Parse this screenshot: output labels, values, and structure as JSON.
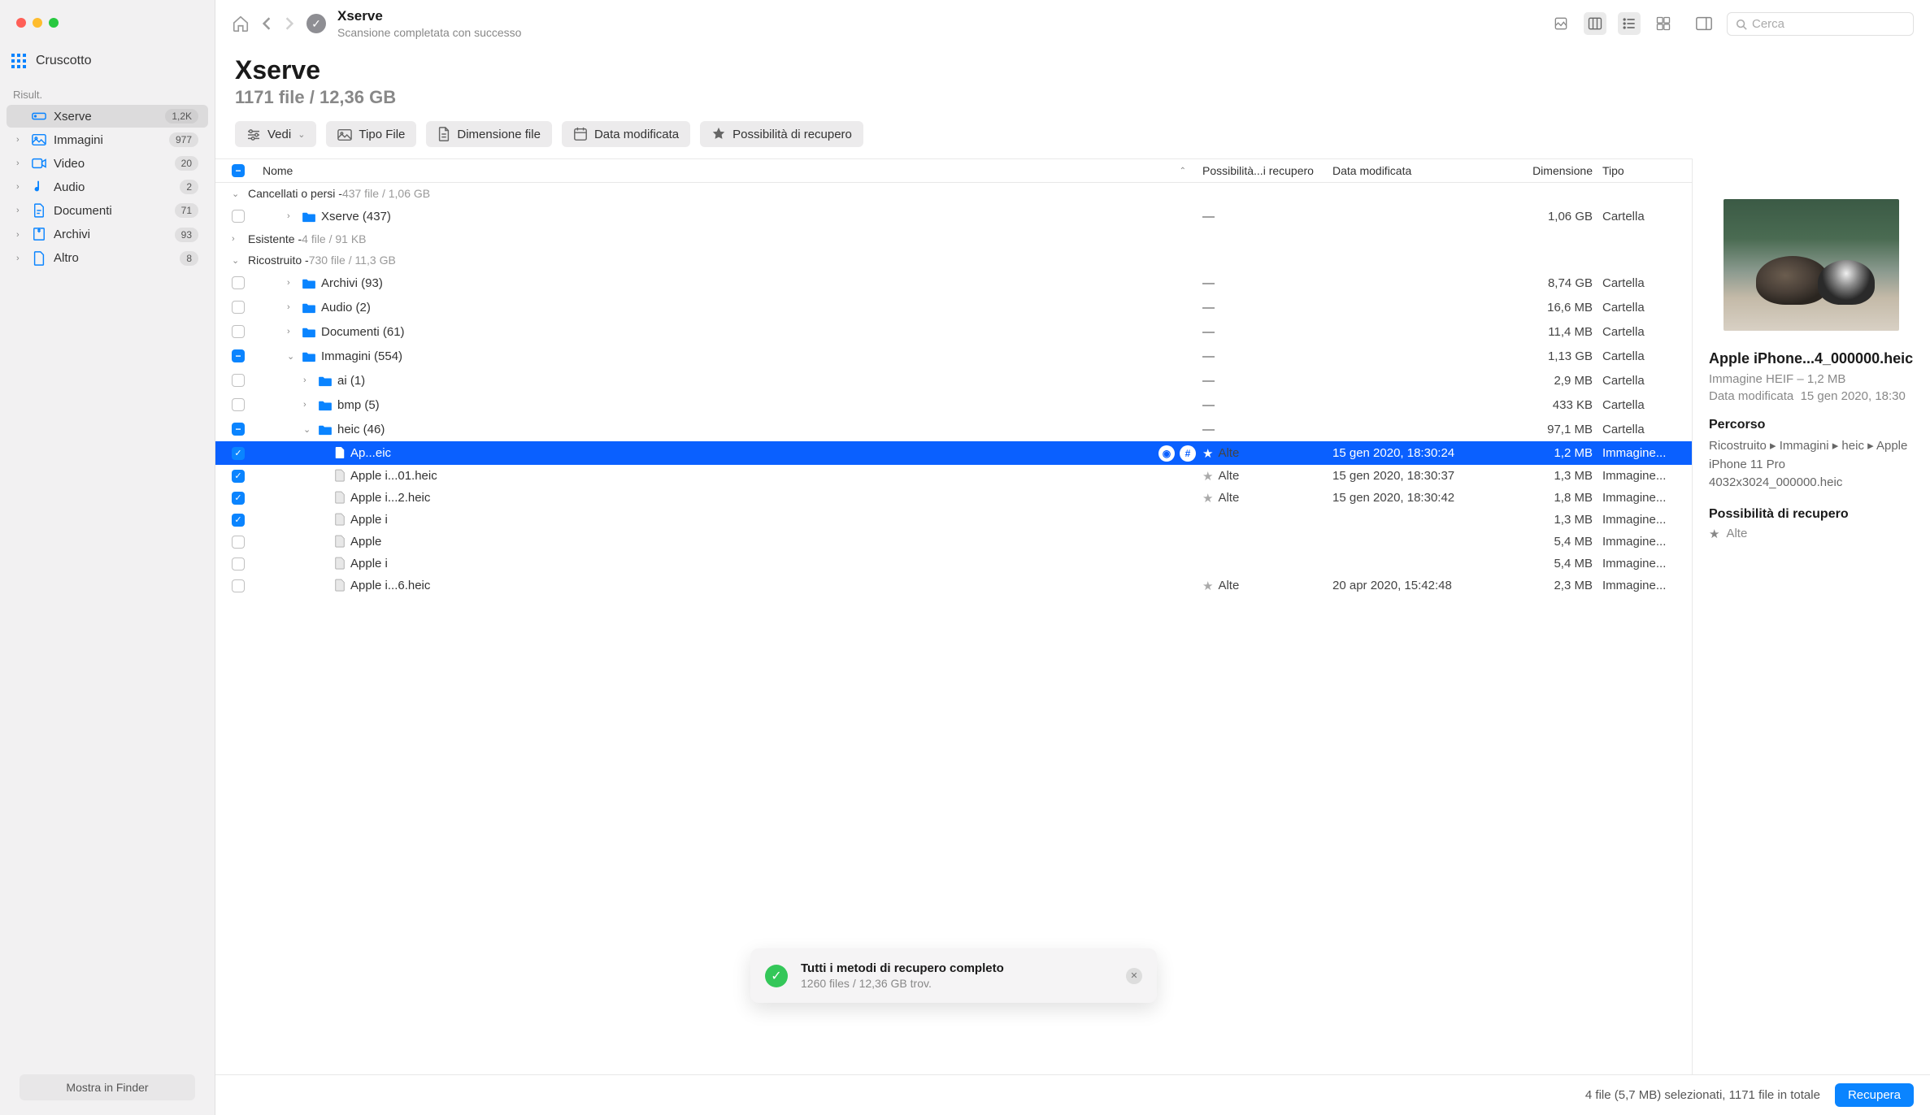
{
  "sidebar": {
    "dashboard": "Cruscotto",
    "section": "Risult.",
    "items": [
      {
        "icon": "drive",
        "label": "Xserve",
        "badge": "1,2K",
        "selected": true,
        "chev": false
      },
      {
        "icon": "image",
        "label": "Immagini",
        "badge": "977",
        "chev": true
      },
      {
        "icon": "video",
        "label": "Video",
        "badge": "20",
        "chev": true
      },
      {
        "icon": "audio",
        "label": "Audio",
        "badge": "2",
        "chev": true
      },
      {
        "icon": "doc",
        "label": "Documenti",
        "badge": "71",
        "chev": true
      },
      {
        "icon": "archive",
        "label": "Archivi",
        "badge": "93",
        "chev": true
      },
      {
        "icon": "other",
        "label": "Altro",
        "badge": "8",
        "chev": true
      }
    ],
    "bottom_btn": "Mostra in Finder"
  },
  "toolbar": {
    "title": "Xserve",
    "subtitle": "Scansione completata con successo",
    "search_placeholder": "Cerca"
  },
  "header": {
    "title": "Xserve",
    "summary": "1171 file / 12,36 GB"
  },
  "filters": {
    "view": "Vedi",
    "type": "Tipo File",
    "size": "Dimensione file",
    "date": "Data modificata",
    "recovery": "Possibilità di recupero"
  },
  "columns": {
    "name": "Nome",
    "poss": "Possibilità...i recupero",
    "date": "Data modificata",
    "size": "Dimensione",
    "type": "Tipo"
  },
  "groups": [
    {
      "name": "Cancellati o persi",
      "meta": "437 file / 1,06 GB",
      "expanded": true,
      "rows": [
        {
          "kind": "folder",
          "check": "empty",
          "indent": 1,
          "chev": "right",
          "name": "Xserve (437)",
          "poss": "—",
          "size": "1,06 GB",
          "type": "Cartella"
        }
      ]
    },
    {
      "name": "Esistente",
      "meta": "4 file / 91 KB",
      "expanded": false,
      "rows": []
    },
    {
      "name": "Ricostruito",
      "meta": "730 file / 11,3 GB",
      "expanded": true,
      "rows": [
        {
          "kind": "folder",
          "check": "empty",
          "indent": 1,
          "chev": "right",
          "name": "Archivi (93)",
          "poss": "—",
          "size": "8,74 GB",
          "type": "Cartella"
        },
        {
          "kind": "folder",
          "check": "empty",
          "indent": 1,
          "chev": "right",
          "name": "Audio (2)",
          "poss": "—",
          "size": "16,6 MB",
          "type": "Cartella"
        },
        {
          "kind": "folder",
          "check": "empty",
          "indent": 1,
          "chev": "right",
          "name": "Documenti (61)",
          "poss": "—",
          "size": "11,4 MB",
          "type": "Cartella"
        },
        {
          "kind": "folder",
          "check": "mixed",
          "indent": 1,
          "chev": "down",
          "name": "Immagini (554)",
          "poss": "—",
          "size": "1,13 GB",
          "type": "Cartella"
        },
        {
          "kind": "folder",
          "check": "empty",
          "indent": 2,
          "chev": "right",
          "name": "ai (1)",
          "poss": "—",
          "size": "2,9 MB",
          "type": "Cartella"
        },
        {
          "kind": "folder",
          "check": "empty",
          "indent": 2,
          "chev": "right",
          "name": "bmp (5)",
          "poss": "—",
          "size": "433 KB",
          "type": "Cartella"
        },
        {
          "kind": "folder",
          "check": "mixed",
          "indent": 2,
          "chev": "down",
          "name": "heic (46)",
          "poss": "—",
          "size": "97,1 MB",
          "type": "Cartella"
        },
        {
          "kind": "file",
          "check": "checked",
          "indent": 3,
          "name": "Ap...eic",
          "poss": "Alte",
          "date": "15 gen 2020, 18:30:24",
          "size": "1,2 MB",
          "type": "Immagine...",
          "selected": true,
          "actions": true
        },
        {
          "kind": "file",
          "check": "checked",
          "indent": 3,
          "name": "Apple i...01.heic",
          "poss": "Alte",
          "date": "15 gen 2020, 18:30:37",
          "size": "1,3 MB",
          "type": "Immagine..."
        },
        {
          "kind": "file",
          "check": "checked",
          "indent": 3,
          "name": "Apple i...2.heic",
          "poss": "Alte",
          "date": "15 gen 2020, 18:30:42",
          "size": "1,8 MB",
          "type": "Immagine..."
        },
        {
          "kind": "file",
          "check": "checked",
          "indent": 3,
          "name": "Apple i",
          "poss": "",
          "date": "",
          "size": "1,3 MB",
          "type": "Immagine..."
        },
        {
          "kind": "file",
          "check": "empty",
          "indent": 3,
          "name": "Apple",
          "poss": "",
          "date": "",
          "size": "5,4 MB",
          "type": "Immagine..."
        },
        {
          "kind": "file",
          "check": "empty",
          "indent": 3,
          "name": "Apple i",
          "poss": "",
          "date": "",
          "size": "5,4 MB",
          "type": "Immagine..."
        },
        {
          "kind": "file",
          "check": "empty",
          "indent": 3,
          "name": "Apple i...6.heic",
          "poss": "Alte",
          "date": "20 apr 2020, 15:42:48",
          "size": "2,3 MB",
          "type": "Immagine..."
        }
      ]
    }
  ],
  "preview": {
    "title": "Apple iPhone...4_000000.heic",
    "format": "Immagine HEIF – 1,2 MB",
    "modified_label": "Data modificata",
    "modified_value": "15 gen 2020, 18:30",
    "path_label": "Percorso",
    "path": "Ricostruito ▸ Immagini ▸ heic ▸ Apple iPhone 11 Pro 4032x3024_000000.heic",
    "recovery_label": "Possibilità di recupero",
    "recovery_value": "Alte"
  },
  "toast": {
    "title": "Tutti i metodi di recupero completo",
    "subtitle": "1260 files / 12,36 GB trov."
  },
  "status": {
    "text": "4 file (5,7 MB) selezionati, 1171 file in totale",
    "button": "Recupera"
  }
}
